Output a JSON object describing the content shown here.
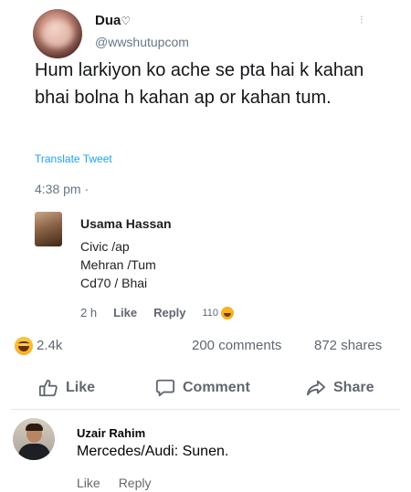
{
  "tweet": {
    "name": "Dua",
    "name_icon": "♡",
    "handle": "@wwshutupcom",
    "menu_glyph": "⁝",
    "text": "Hum larkiyon ko ache se pta hai k kahan bhai bolna h kahan ap or kahan tum.",
    "translate_label": "Translate Tweet",
    "time": "4:38 pm ·"
  },
  "reply": {
    "name": "Usama Hassan",
    "lines": [
      "Civic /ap",
      "Mehran /Tum",
      "Cd70 / Bhai"
    ],
    "age": "2 h",
    "like_label": "Like",
    "reply_label": "Reply",
    "reaction_count": "110"
  },
  "stats": {
    "reaction_icon": "laughing-emoji-icon",
    "reaction_count": "2.4k",
    "comments": "200 comments",
    "shares": "872 shares"
  },
  "actions": {
    "like": "Like",
    "comment": "Comment",
    "share": "Share"
  },
  "comment": {
    "name": "Uzair Rahim",
    "text": "Mercedes/Audi: Sunen.",
    "like_label": "Like",
    "reply_label": "Reply"
  },
  "colors": {
    "link_blue": "#1da1f2",
    "meta_gray": "#606770",
    "laugh_yellow": "#f7b125"
  }
}
